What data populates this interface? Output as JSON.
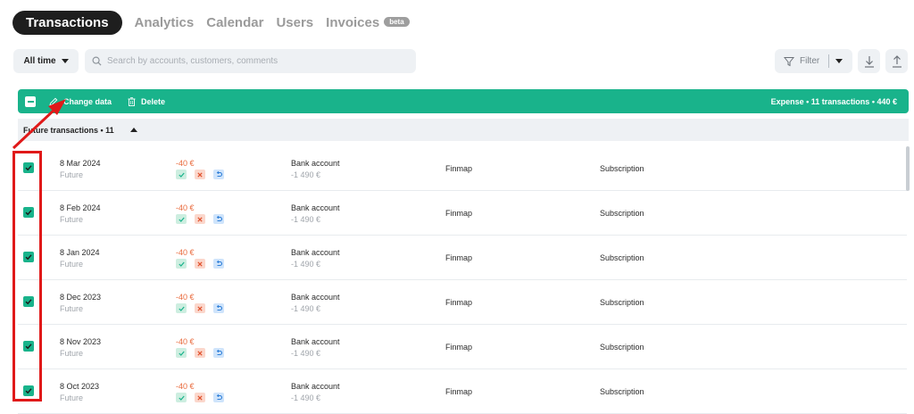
{
  "nav": {
    "active_tab": "Transactions",
    "tabs": [
      "Analytics",
      "Calendar",
      "Users",
      "Invoices"
    ],
    "beta_badge": "beta"
  },
  "toolbar": {
    "period": "All time",
    "search_placeholder": "Search by accounts, customers, comments",
    "filter_label": "Filter"
  },
  "action_bar": {
    "change_label": "Change data",
    "delete_label": "Delete",
    "summary": "Expense • 11 transactions • 440 €"
  },
  "group": {
    "label": "Future transactions • 11"
  },
  "rows": [
    {
      "date": "8 Mar 2024",
      "status": "Future",
      "amount": "-40 €",
      "account": "Bank account",
      "balance": "-1 490 €",
      "counterparty": "Finmap",
      "category": "Subscription",
      "checked": true
    },
    {
      "date": "8 Feb 2024",
      "status": "Future",
      "amount": "-40 €",
      "account": "Bank account",
      "balance": "-1 490 €",
      "counterparty": "Finmap",
      "category": "Subscription",
      "checked": true
    },
    {
      "date": "8 Jan 2024",
      "status": "Future",
      "amount": "-40 €",
      "account": "Bank account",
      "balance": "-1 490 €",
      "counterparty": "Finmap",
      "category": "Subscription",
      "checked": true
    },
    {
      "date": "8 Dec 2023",
      "status": "Future",
      "amount": "-40 €",
      "account": "Bank account",
      "balance": "-1 490 €",
      "counterparty": "Finmap",
      "category": "Subscription",
      "checked": true
    },
    {
      "date": "8 Nov 2023",
      "status": "Future",
      "amount": "-40 €",
      "account": "Bank account",
      "balance": "-1 490 €",
      "counterparty": "Finmap",
      "category": "Subscription",
      "checked": true
    },
    {
      "date": "8 Oct 2023",
      "status": "Future",
      "amount": "-40 €",
      "account": "Bank account",
      "balance": "-1 490 €",
      "counterparty": "Finmap",
      "category": "Subscription",
      "checked": true
    }
  ],
  "colors": {
    "accent": "#19b38b",
    "expense": "#e9693b",
    "annotation": "#e01919"
  }
}
